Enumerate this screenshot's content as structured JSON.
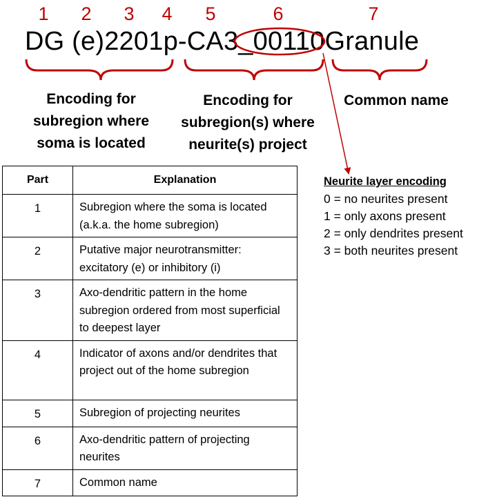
{
  "part_numbers": [
    "1",
    "2",
    "3",
    "4",
    "5",
    "6",
    "7"
  ],
  "code_segments": {
    "s1": "DG",
    "s2": " (e)",
    "s3": "2201",
    "s4": "p",
    "s5": "-CA3",
    "s6": "_00110",
    "s7": "Granule"
  },
  "captions": {
    "soma": [
      "Encoding for",
      "subregion where",
      "soma is located"
    ],
    "neurite": [
      "Encoding for",
      "subregion(s) where",
      "neurite(s) project"
    ],
    "common": "Common name"
  },
  "legend": {
    "title": "Neurite layer encoding",
    "items": [
      "0 = no neurites present",
      "1 = only axons present",
      "2 = only dendrites present",
      "3 = both neurites present"
    ]
  },
  "table": {
    "headers": [
      "Part",
      "Explanation"
    ],
    "rows": [
      {
        "part": "1",
        "text": "Subregion where the soma is located (a.k.a. the home subregion)"
      },
      {
        "part": "2",
        "text": "Putative major neurotransmitter: excitatory (e) or inhibitory (i)"
      },
      {
        "part": "3",
        "text": "Axo-dendritic pattern in the home subregion ordered from most superficial to deepest layer"
      },
      {
        "part": "4",
        "text": "Indicator of axons and/or dendrites that project out of the home subregion"
      },
      {
        "part": "5",
        "text": "Subregion of projecting neurites"
      },
      {
        "part": "6",
        "text": "Axo-dendritic pattern of projecting neurites"
      },
      {
        "part": "7",
        "text": "Common name"
      }
    ]
  },
  "colors": {
    "accent": "#c00000",
    "text": "#000000"
  }
}
